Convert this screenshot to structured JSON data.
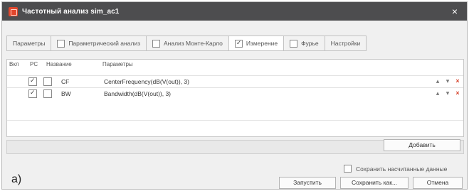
{
  "window": {
    "title": "Частотный анализ sim_ac1",
    "close_glyph": "×"
  },
  "tabs": [
    {
      "label": "Параметры",
      "has_checkbox": false,
      "checked": false
    },
    {
      "label": "Параметрический анализ",
      "has_checkbox": true,
      "checked": false
    },
    {
      "label": "Анализ Монте-Карло",
      "has_checkbox": true,
      "checked": false
    },
    {
      "label": "Измерение",
      "has_checkbox": true,
      "checked": true
    },
    {
      "label": "Фурье",
      "has_checkbox": true,
      "checked": false
    },
    {
      "label": "Настройки",
      "has_checkbox": false,
      "checked": false
    }
  ],
  "grid": {
    "headers": {
      "all": "Вкл",
      "pc": "PC",
      "name": "Название",
      "params": "Параметры"
    },
    "rows": [
      {
        "enabled": true,
        "pc": false,
        "name": "CF",
        "params": "CenterFrequency(dB(V(out)), 3)"
      },
      {
        "enabled": true,
        "pc": false,
        "name": "BW",
        "params": "Bandwidth(dB(V(out)), 3)"
      }
    ],
    "row_actions": {
      "up": "▴",
      "down": "▾",
      "delete": "×"
    }
  },
  "buttons": {
    "add": "Добавить",
    "run": "Запустить",
    "save_as": "Сохранить как...",
    "cancel": "Отмена"
  },
  "options": {
    "save_computed_label": "Сохранить насчитанные данные",
    "save_computed_checked": false
  },
  "figure_label": "a)",
  "colors": {
    "titlebar": "#4d4d4f",
    "app_icon": "#e0462c",
    "delete_action": "#d6412a",
    "background": "#f0f0f0"
  },
  "icons": {
    "app": "app-logo-icon",
    "close": "close-icon",
    "move_up": "arrow-up-icon",
    "move_down": "arrow-down-icon",
    "delete": "delete-icon"
  }
}
